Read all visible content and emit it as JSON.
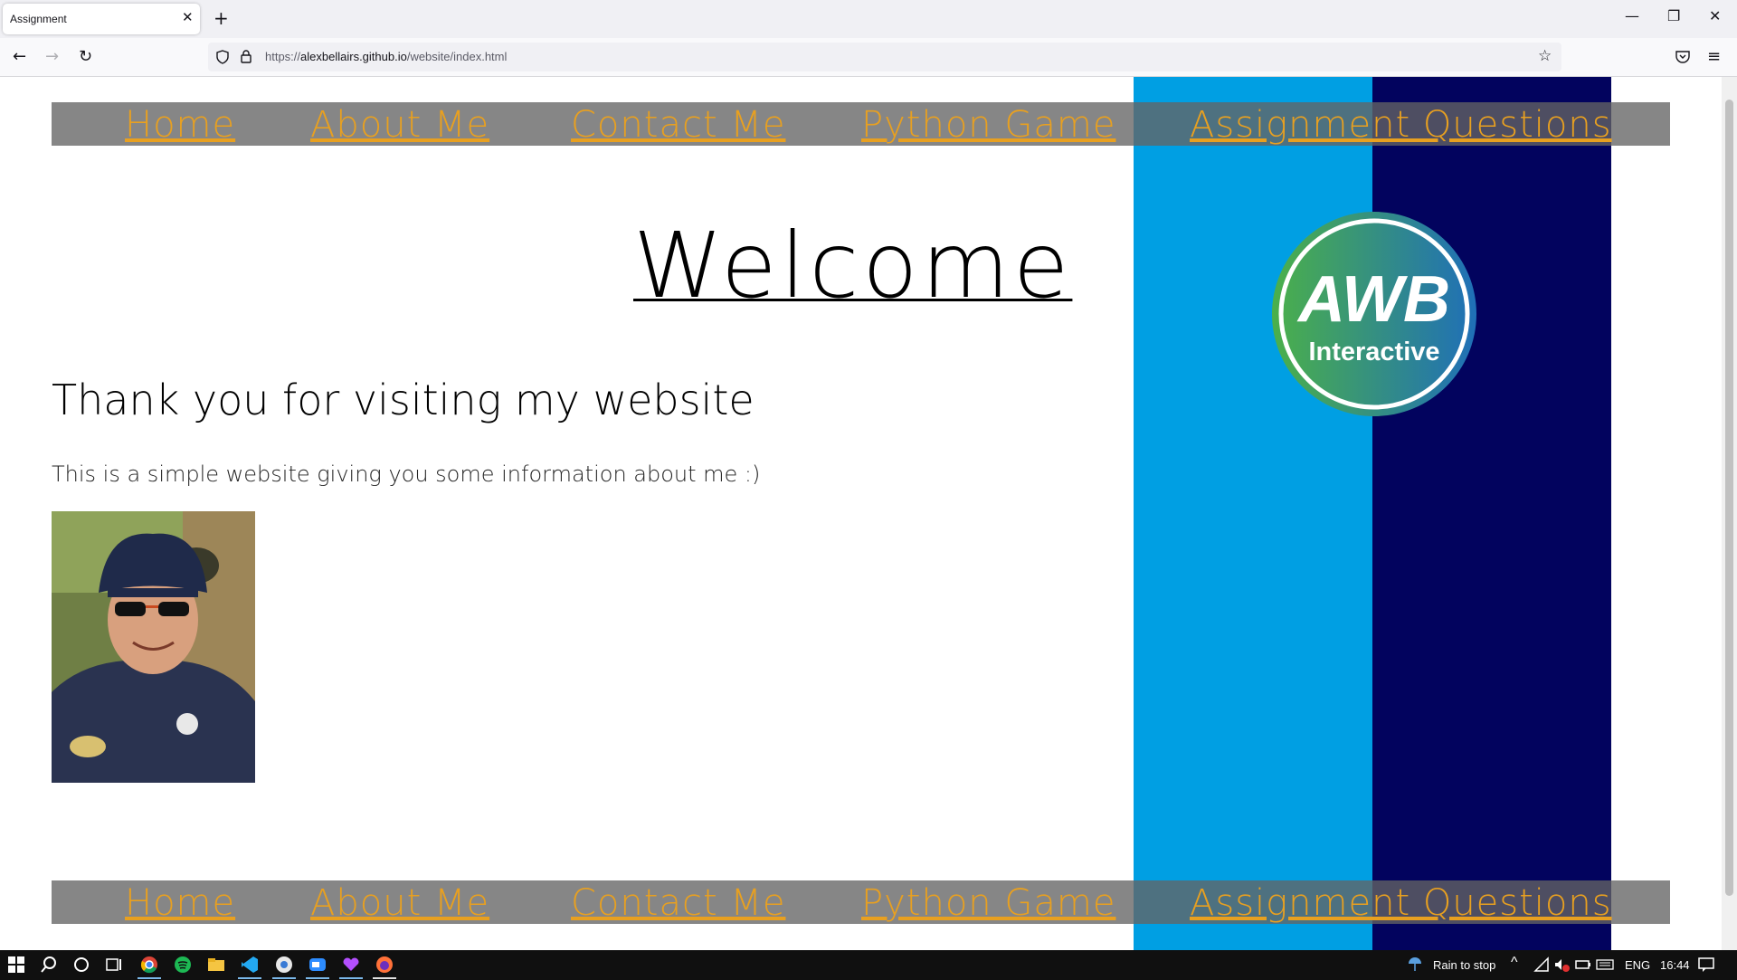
{
  "browser": {
    "tab_title": "Assignment",
    "tab_close": "✕",
    "new_tab": "+",
    "url_scheme": "https://",
    "url_host": "alexbellairs.github.io",
    "url_path": "/website/index.html",
    "window_controls": {
      "minimize": "—",
      "restore": "❐",
      "close": "✕"
    }
  },
  "nav": {
    "items": [
      "Home",
      "About Me",
      "Contact Me",
      "Python Game",
      "Assignment Questions"
    ]
  },
  "page": {
    "heading": "Welcome",
    "subheading": "Thank you for visiting my website",
    "intro": "This is a simple website giving you some information about me :)",
    "logo_text_top": "AWB",
    "logo_text_bottom": "Interactive",
    "colors": {
      "stripe_light": "#009fe3",
      "stripe_dark": "#02035e",
      "link": "#e8a020",
      "menu_bar": "#646464"
    }
  },
  "taskbar": {
    "weather": "Rain to stop",
    "language": "ENG",
    "time": "16:44",
    "icons": [
      "windows-start-icon",
      "search-icon",
      "cortana-icon",
      "task-view-icon",
      "chrome-icon",
      "spotify-icon",
      "file-explorer-icon",
      "vscode-icon",
      "app-icon",
      "zoom-icon",
      "heart-app-icon",
      "firefox-icon"
    ]
  }
}
